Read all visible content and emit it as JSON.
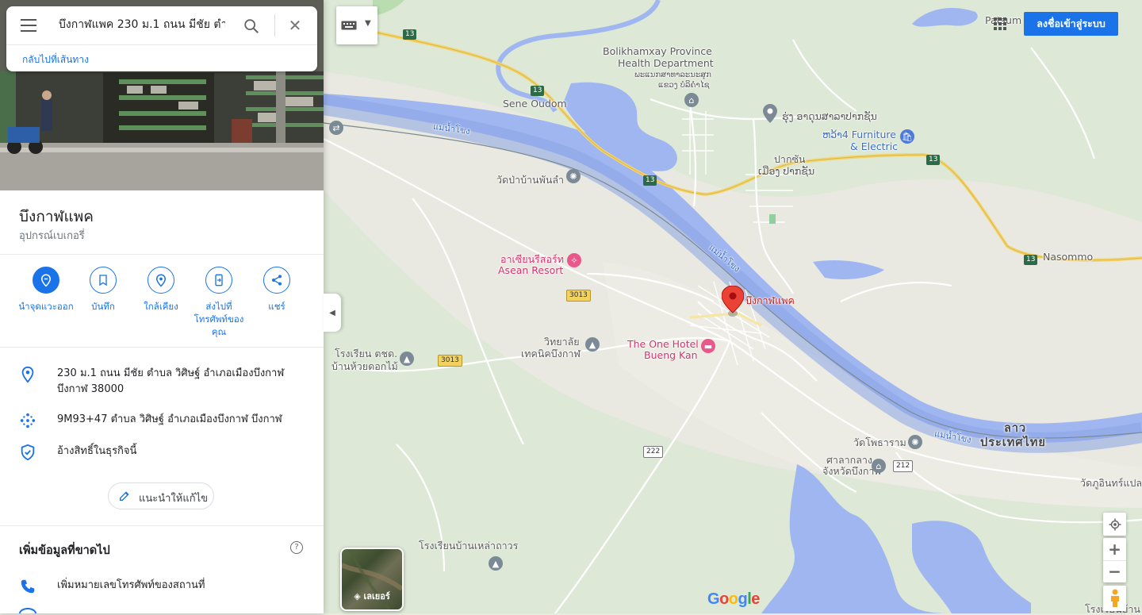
{
  "search": {
    "query": "บึงกาฬแพค 230 ม.1 ถนน มีชัย ตำบ",
    "back_link": "กลับไปที่เส้นทาง"
  },
  "place": {
    "name": "บึงกาฬแพค",
    "category": "อุปกรณ์เบเกอรี่"
  },
  "actions": [
    {
      "label": "นำจุดแวะออก",
      "icon": "remove-stop-icon"
    },
    {
      "label": "บันทึก",
      "icon": "bookmark-icon"
    },
    {
      "label": "ใกล้เคียง",
      "icon": "nearby-icon"
    },
    {
      "label": "ส่งไปที่โทรศัพท์ของคุณ",
      "icon": "send-to-phone-icon"
    },
    {
      "label": "แชร์",
      "icon": "share-icon"
    }
  ],
  "info": {
    "address": "230 ม.1 ถนน มีชัย ตำบล วิศิษฐ์ อำเภอเมืองบึงกาฬ บึงกาฬ 38000",
    "plus_code": "9M93+47 ตำบล วิศิษฐ์ อำเภอเมืองบึงกาฬ บึงกาฬ",
    "claim": "อ้างสิทธิ์ในธุรกิจนี้"
  },
  "suggest_edit": "แนะนำให้แก้ไข",
  "missing": {
    "title": "เพิ่มข้อมูลที่ขาดไป",
    "add_phone": "เพิ่มหมายเลขโทรศัพท์ของสถานที่"
  },
  "header": {
    "sign_in": "ลงชื่อเข้าสู่ระบบ"
  },
  "map": {
    "layers_label": "เลเยอร์",
    "google": "Google",
    "labels": {
      "patsum": "Patsum",
      "bolikhamxay": "Bolikhamxay Province",
      "health_dept": "Health Department",
      "lao_health_1": "ພະແນກສາທາລະນະສຸກ",
      "lao_health_2": "ແຂວງ ບໍລິຄຳໄຊ",
      "sene_oudom": "Sene Oudom",
      "lao_school": "ຮຸ່ງ ອາດຸນສາລາປາກຊັນ",
      "furniture_1": "ຫວ້າ4 Furniture",
      "furniture_2": "& Electric",
      "pakxan_th": "ปากซัน",
      "pakxan_lao": "ເມືອງ ປາກຊັນ",
      "mekong_1": "แม่น้ำโขง",
      "mekong_2": "แม่น้ำโขง",
      "mekong_3": "แม่น้ำโขง",
      "wat_pa": "วัดป่าบ้านพันลำ",
      "nasommo": "Nasommo",
      "asean_1": "อาเซียนรีสอร์ท",
      "asean_2": "Asean Resort",
      "one_hotel_1": "The One Hotel",
      "one_hotel_2": "Bueng Kan",
      "college_1": "วิทยาลัย",
      "college_2": "เทคนิคบึงกาฬ",
      "school_1": "โรงเรียน ตชด.",
      "school_2": "บ้านห้วยดอกไม้",
      "wat_pho": "วัดโพธาราม",
      "court_1": "ศาลากลาง",
      "court_2": "จังหวัดบึงกาฬ",
      "wat_tu": "วัดภูอินทร์แปลง",
      "lao": "ลาว",
      "thailand": "ประเทศไทย",
      "school_lao": "โรงเรียนบ้านเหล่าถาวร",
      "school_br": "โรงเรียนบ้าน",
      "pin": "บึงกาฬแพค"
    },
    "routes": [
      "13",
      "13",
      "13",
      "13",
      "13",
      "3013",
      "3013",
      "222",
      "212"
    ]
  }
}
